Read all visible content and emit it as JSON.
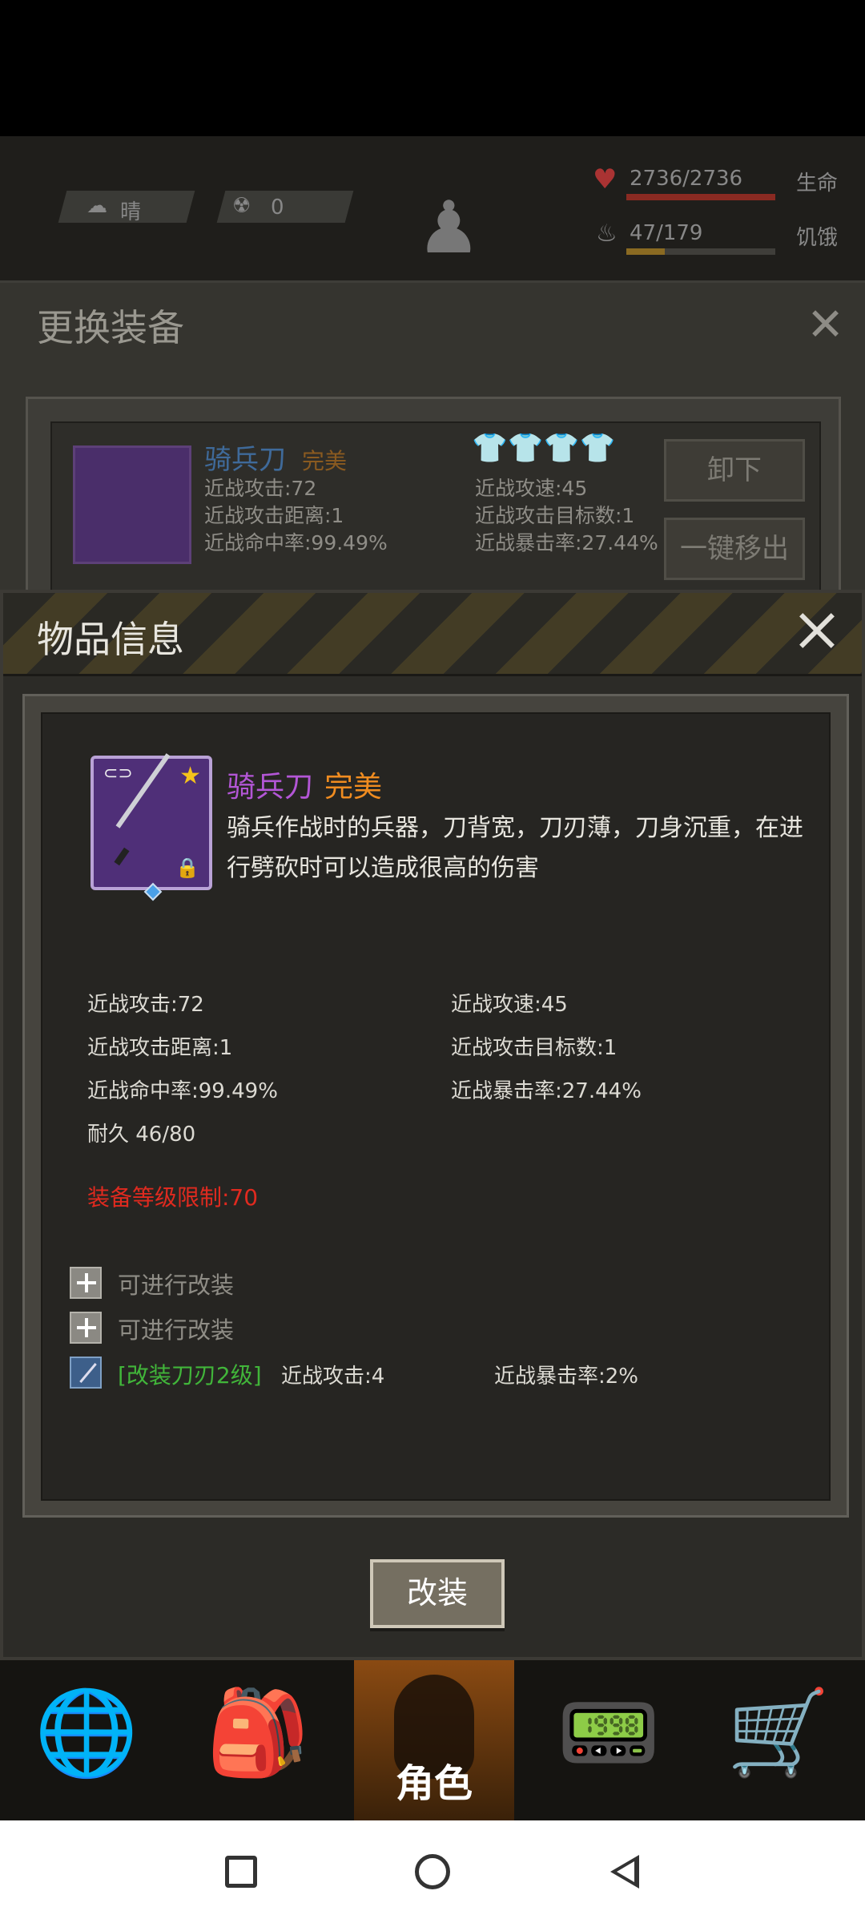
{
  "hud": {
    "weather": "晴",
    "radiation": "0",
    "hp_value": "2736/2736",
    "hp_label": "生命",
    "hunger_value": "47/179",
    "hunger_label": "饥饿"
  },
  "equip_window": {
    "title": "更换装备",
    "item_name": "骑兵刀",
    "item_quality": "完美",
    "stats": [
      "近战攻击:72",
      "近战攻速:45",
      "近战攻击距离:1",
      "近战攻击目标数:1",
      "近战命中率:99.49%",
      "近战暴击率:27.44%"
    ],
    "unequip_label": "卸下",
    "remove_label": "一键移出"
  },
  "dialog": {
    "title": "物品信息",
    "item": {
      "name": "骑兵刀",
      "quality": "完美",
      "description": "骑兵作战时的兵器，刀背宽，刀刃薄，刀身沉重，在进行劈砍时可以造成很高的伤害"
    },
    "stats": {
      "left": [
        "近战攻击:72",
        "近战攻击距离:1",
        "近战命中率:99.49%",
        "耐久 46/80"
      ],
      "right": [
        "近战攻速:45",
        "近战攻击目标数:1",
        "近战暴击率:27.44%"
      ]
    },
    "requirement": "装备等级限制:70",
    "mods": {
      "slot1": "可进行改装",
      "slot2": "可进行改装",
      "installed_name": "[改装刀刃2级]",
      "installed_stat1": "近战攻击:4",
      "installed_stat2": "近战暴击率:2%"
    },
    "modify_button": "改装"
  },
  "tabbar": {
    "active_label": "角色",
    "icons": [
      "globe-icon",
      "backpack-icon",
      "character-icon",
      "radio-icon",
      "cart-icon"
    ]
  },
  "colors": {
    "item_name": "#b356d6",
    "quality": "#f08c20",
    "requirement": "#e02a1f",
    "mod_installed": "#41b53a"
  }
}
